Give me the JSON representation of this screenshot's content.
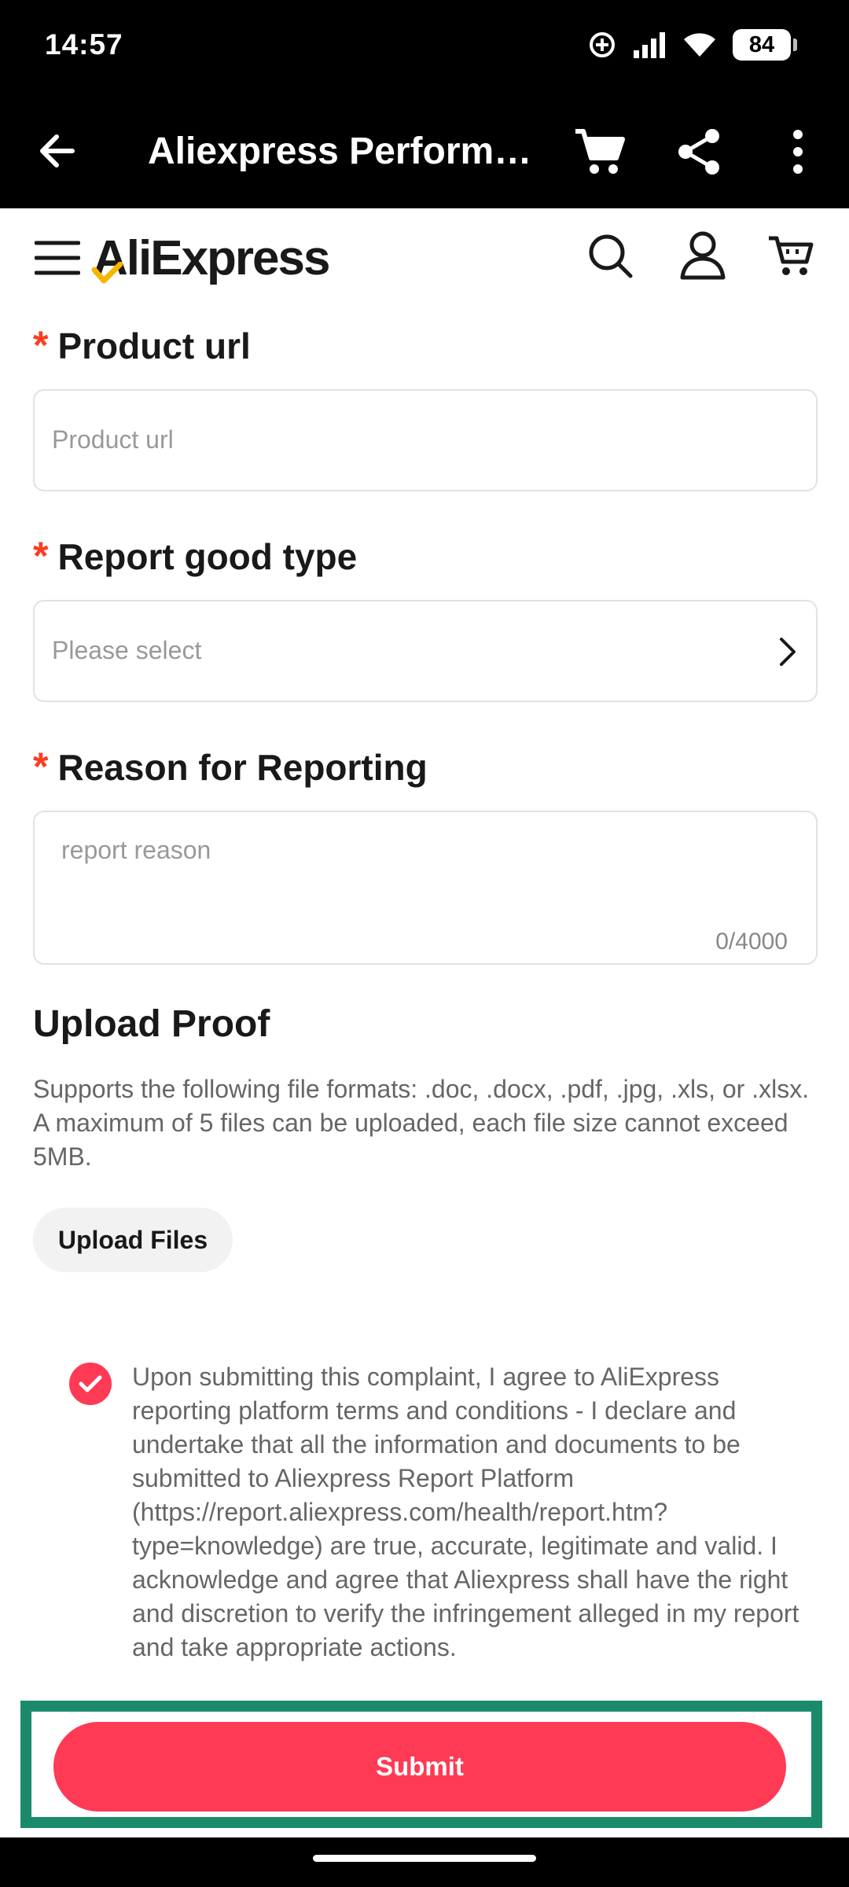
{
  "status_bar": {
    "time": "14:57",
    "battery": "84"
  },
  "app_bar": {
    "title": "Aliexpress Performan..."
  },
  "site_header": {
    "logo": "AliExpress"
  },
  "form": {
    "product_url": {
      "label": "Product url",
      "placeholder": "Product url",
      "required_mark": "*"
    },
    "report_type": {
      "label": "Report good type",
      "placeholder": "Please select",
      "required_mark": "*"
    },
    "reason": {
      "label": "Reason for Reporting",
      "placeholder": "report reason",
      "counter": "0/4000",
      "required_mark": "*"
    }
  },
  "upload": {
    "title": "Upload Proof",
    "description": "Supports the following file formats: .doc, .docx, .pdf, .jpg, .xls, or .xlsx. A maximum of 5 files can be uploaded, each file size cannot exceed 5MB.",
    "button": "Upload Files"
  },
  "agreement": {
    "checked": true,
    "text": "Upon submitting this complaint, I agree to AliExpress reporting platform terms and conditions - I declare and undertake that all the information and documents to be submitted to Aliexpress Report Platform (https://report.aliexpress.com/health/report.htm?type=knowledge) are true, accurate, legitimate and valid. I acknowledge and agree that Aliexpress shall have the right and discretion to verify the infringement alleged in my report and take appropriate actions."
  },
  "submit": {
    "label": "Submit"
  },
  "colors": {
    "accent": "#ff3a55",
    "required": "#ff3b1f",
    "highlight": "#1b8a6b"
  }
}
